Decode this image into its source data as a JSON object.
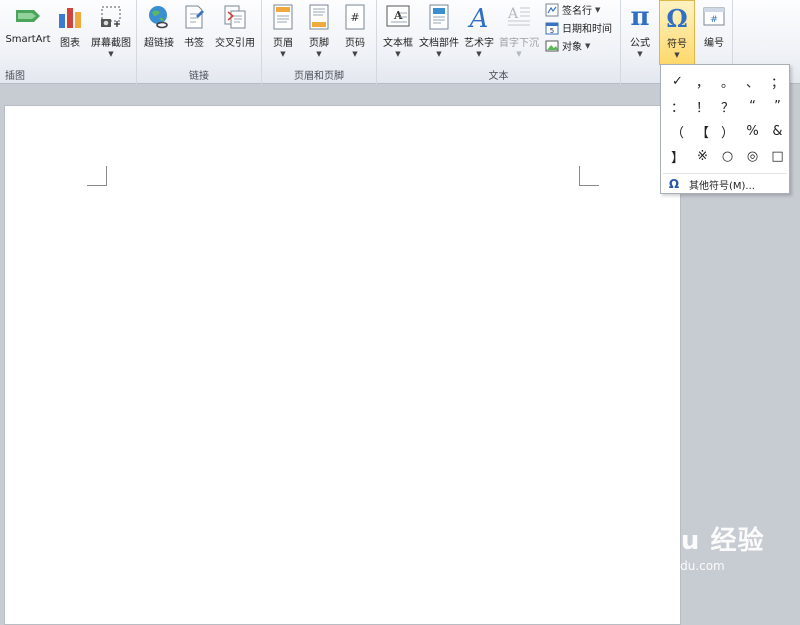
{
  "ribbon": {
    "groups": {
      "illustrations": {
        "label": "插图",
        "smartart": "SmartArt",
        "chart": "图表",
        "screenshot": "屏幕截图"
      },
      "links": {
        "label": "链接",
        "hyperlink": "超链接",
        "bookmark": "书签",
        "cross_reference": "交叉引用"
      },
      "header_footer": {
        "label": "页眉和页脚",
        "header": "页眉",
        "footer": "页脚",
        "page_number": "页码"
      },
      "text": {
        "label": "文本",
        "text_box": "文本框",
        "quick_parts": "文档部件",
        "wordart": "艺术字",
        "drop_cap": "首字下沉",
        "signature_line": "签名行",
        "date_time": "日期和时间",
        "object": "对象"
      },
      "symbols": {
        "equation": "公式",
        "symbol": "符号",
        "number": "编号"
      }
    }
  },
  "symbol_menu": {
    "symbols": [
      "✓",
      "，",
      "。",
      "、",
      "；",
      "：",
      "！",
      "？",
      "“",
      "”",
      "（",
      "【",
      "）",
      "%",
      "&",
      "】",
      "※",
      "○",
      "◎",
      "□"
    ],
    "more_symbols": "其他符号(M)..."
  },
  "watermark": {
    "brand": "Baidu 经验",
    "url": "jingyan.baidu.com"
  },
  "colors": {
    "active_tab": "#ffd86a",
    "page": "#ffffff",
    "workspace": "#c7cbd2"
  }
}
